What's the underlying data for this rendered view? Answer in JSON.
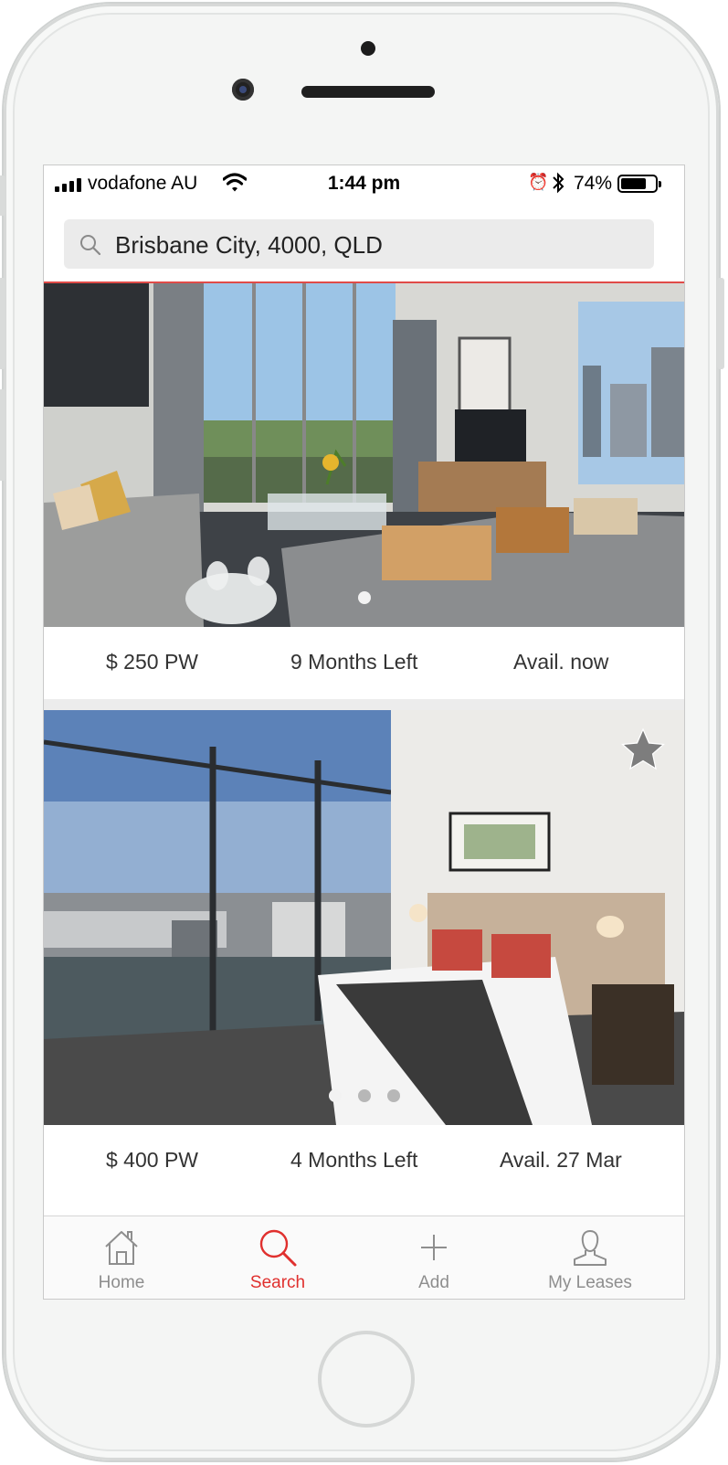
{
  "status_bar": {
    "carrier": "vodafone AU",
    "time": "1:44 pm",
    "battery_percent": "74%",
    "battery_level": 0.74
  },
  "search": {
    "value": "Brisbane City, 4000, QLD"
  },
  "listings": [
    {
      "price": "$ 250 PW",
      "lease_remaining": "9 Months Left",
      "availability": "Avail. now",
      "photo_count": 1,
      "active_photo": 0,
      "favorited": false
    },
    {
      "price": "$ 400 PW",
      "lease_remaining": "4 Months Left",
      "availability": "Avail. 27 Mar",
      "photo_count": 3,
      "active_photo": 0,
      "favorited": false
    }
  ],
  "tabbar": {
    "tabs": [
      {
        "label": "Home",
        "icon": "home-icon",
        "active": false
      },
      {
        "label": "Search",
        "icon": "search-icon",
        "active": true
      },
      {
        "label": "Add",
        "icon": "plus-icon",
        "active": false
      },
      {
        "label": "My Leases",
        "icon": "user-icon",
        "active": false
      }
    ]
  },
  "colors": {
    "accent": "#e0302e",
    "inactive": "#8e8e8e"
  }
}
